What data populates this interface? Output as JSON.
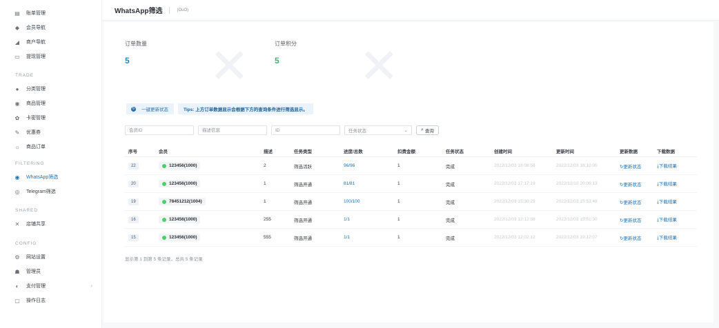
{
  "sidebar": {
    "top_items": [
      {
        "label": "账单管理",
        "icon": "bill-icon",
        "glyph": "▤"
      },
      {
        "label": "会员导航",
        "icon": "member-icon",
        "glyph": "◆"
      },
      {
        "label": "商户导航",
        "icon": "merchant-icon",
        "glyph": "◢"
      },
      {
        "label": "提现管理",
        "icon": "withdraw-icon",
        "glyph": "▭"
      }
    ],
    "sections": [
      {
        "title": "TRADE",
        "items": [
          {
            "label": "分类管理",
            "icon": "category-icon",
            "glyph": "●"
          },
          {
            "label": "商品管理",
            "icon": "goods-icon",
            "glyph": "◉"
          },
          {
            "label": "卡密管理",
            "icon": "card-icon",
            "glyph": "✿"
          },
          {
            "label": "优惠券",
            "icon": "coupon-icon",
            "glyph": "✎"
          },
          {
            "label": "商品订单",
            "icon": "order-icon",
            "glyph": "☼"
          }
        ]
      },
      {
        "title": "FILTERING",
        "items": [
          {
            "label": "WhatsApp筛选",
            "icon": "whatsapp-icon",
            "glyph": "◉",
            "active": true
          },
          {
            "label": "Telegram筛选",
            "icon": "telegram-icon",
            "glyph": "◎"
          }
        ]
      },
      {
        "title": "SHARED",
        "items": [
          {
            "label": "店铺共享",
            "icon": "share-icon",
            "glyph": "✕"
          }
        ]
      },
      {
        "title": "CONFIG",
        "items": [
          {
            "label": "网站设置",
            "icon": "settings-icon",
            "glyph": "⚙"
          },
          {
            "label": "管理员",
            "icon": "admin-icon",
            "glyph": "☗"
          },
          {
            "label": "支付管理",
            "icon": "payment-icon",
            "glyph": "◐",
            "chevron": "›"
          },
          {
            "label": "操作日志",
            "icon": "log-icon",
            "glyph": "▢"
          }
        ]
      }
    ]
  },
  "header": {
    "title": "WhatsApp筛选",
    "subtitle": "(OuO)"
  },
  "stats": [
    {
      "label": "订单数量",
      "value": "5",
      "color": "#1f88c9"
    },
    {
      "label": "订单积分",
      "value": "5",
      "color": "#3db56a"
    }
  ],
  "actions": {
    "refresh_label": "一键更新状态",
    "tips": "Tips: 上方订单数据显示会根据下方的查询条件进行筛选显示。"
  },
  "filters": {
    "member_id_placeholder": "会员ID",
    "desc_placeholder": "描述信息",
    "id_placeholder": "ID",
    "status_placeholder": "任务状态",
    "query_label": "查询"
  },
  "table": {
    "columns": [
      "序号",
      "会员",
      "描述",
      "任务类型",
      "进度/总数",
      "扣费金额",
      "任务状态",
      "创建时间",
      "更新时间",
      "更新数据",
      "下载数据"
    ],
    "rows": [
      {
        "id": "22",
        "member": "123456(1000)",
        "desc": "2",
        "type": "筛选活跃",
        "progress": "96/96",
        "fee": "1",
        "status": "完成",
        "created": "2022/12/03 18:08:58",
        "updated": "2022/12/03 18:10:00",
        "update_action": "更新状态",
        "download_action": "下载结果"
      },
      {
        "id": "20",
        "member": "123456(1000)",
        "desc": "1",
        "type": "筛选开通",
        "progress": "81/81",
        "fee": "1",
        "status": "完成",
        "created": "2022/12/03 17:17:19",
        "updated": "2022/12/10 20:06:13",
        "update_action": "更新状态",
        "download_action": "下载结果"
      },
      {
        "id": "19",
        "member": "78451212(1004)",
        "desc": "1",
        "type": "筛选开通",
        "progress": "100/100",
        "fee": "1",
        "status": "完成",
        "created": "2022/12/03 15:30:29",
        "updated": "2022/12/03 15:53:48",
        "update_action": "更新状态",
        "download_action": "下载结果"
      },
      {
        "id": "16",
        "member": "123456(1000)",
        "desc": "255",
        "type": "筛选开通",
        "progress": "1/1",
        "fee": "1",
        "status": "完成",
        "created": "2022/12/03 12:12:38",
        "updated": "2022/12/03 15:51:30",
        "update_action": "更新状态",
        "download_action": "下载结果"
      },
      {
        "id": "15",
        "member": "123456(1000)",
        "desc": "555",
        "type": "筛选开通",
        "progress": "1/1",
        "fee": "1",
        "status": "完成",
        "created": "2022/12/03 12:02:12",
        "updated": "2022/12/03 19:12:07",
        "update_action": "更新状态",
        "download_action": "下载结果"
      }
    ],
    "footer": "显示第 1 到第 5 条记录，总共 5 条记录"
  }
}
